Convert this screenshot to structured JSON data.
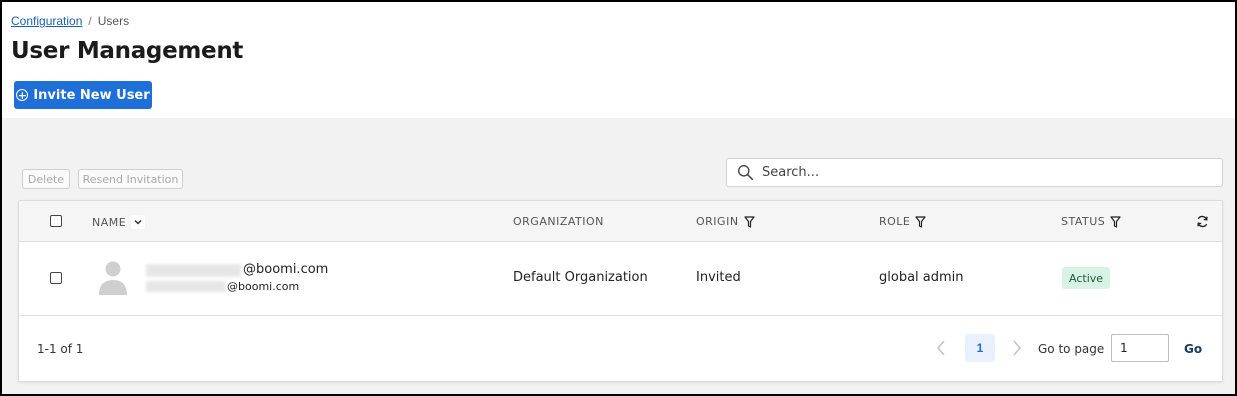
{
  "breadcrumb": {
    "parent": "Configuration",
    "separator": "/",
    "current": "Users"
  },
  "page": {
    "title": "User Management"
  },
  "actions": {
    "invite_label": "Invite New User",
    "delete_label": "Delete",
    "resend_label": "Resend Invitation"
  },
  "search": {
    "placeholder": "Search...",
    "value": ""
  },
  "table": {
    "columns": {
      "name": "NAME",
      "organization": "ORGANIZATION",
      "origin": "ORIGIN",
      "role": "ROLE",
      "status": "STATUS"
    },
    "rows": [
      {
        "email": "@boomi.com",
        "email_secondary": "@boomi.com",
        "organization": "Default Organization",
        "origin": "Invited",
        "role": "global admin",
        "status": "Active"
      }
    ]
  },
  "pagination": {
    "range": "1-1 of 1",
    "current_page": "1",
    "goto_label": "Go to page",
    "goto_value": "1",
    "go_label": "Go"
  },
  "colors": {
    "primary": "#1f6fd9",
    "status_active_bg": "#d9f2e6",
    "body_bg": "#f2f2f2"
  },
  "icons": {
    "invite": "plus-circle-icon",
    "search": "search-icon",
    "sort": "chevron-down-icon",
    "filter": "filter-icon",
    "refresh": "refresh-icon",
    "avatar": "user-avatar-icon",
    "prev": "chevron-left-icon",
    "next": "chevron-right-icon"
  }
}
